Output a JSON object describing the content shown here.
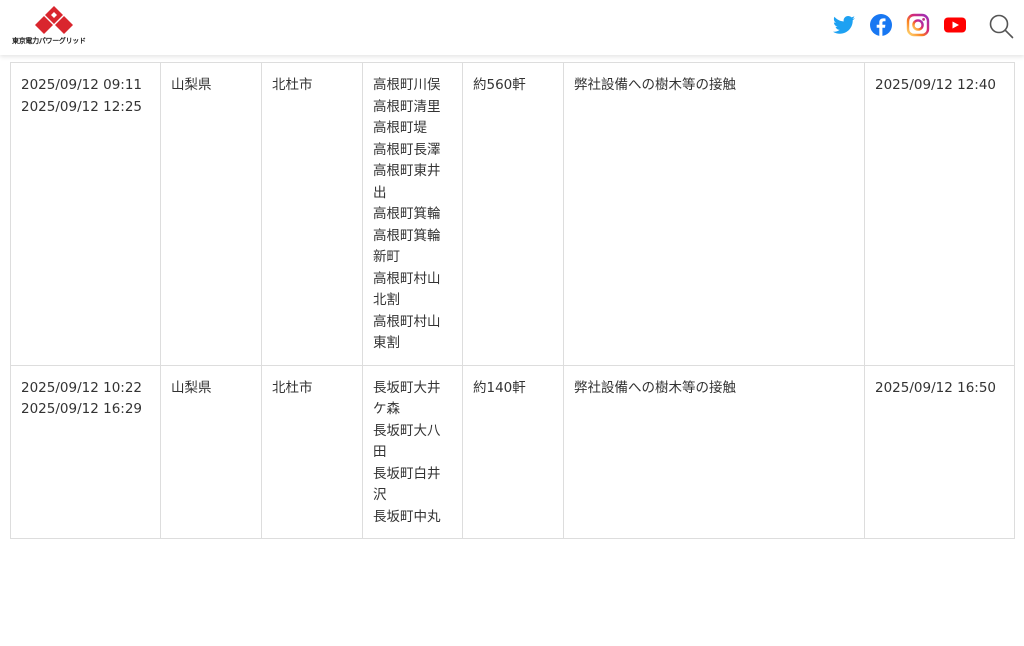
{
  "header": {
    "logo_text": "東京電力パワーグリッド",
    "brand_color": "#d9262e",
    "social": [
      {
        "name": "twitter",
        "icon": "twitter-icon",
        "color": "#1da1f2"
      },
      {
        "name": "facebook",
        "icon": "facebook-icon",
        "color": "#1877f2"
      },
      {
        "name": "instagram",
        "icon": "instagram-icon",
        "color": "#e1306c"
      },
      {
        "name": "youtube",
        "icon": "youtube-icon",
        "color": "#ff0000"
      }
    ],
    "search_icon": "search-icon"
  },
  "outages": [
    {
      "occurred": "2025/09/12 09:11",
      "restored": "2025/09/12 12:25",
      "prefecture": "山梨県",
      "city": "北杜市",
      "areas": [
        "高根町川俣",
        "高根町清里",
        "高根町堤",
        "高根町長澤",
        "高根町東井出",
        "高根町箕輪",
        "高根町箕輪新町",
        "高根町村山北割",
        "高根町村山東割"
      ],
      "households": "約560軒",
      "cause": "弊社設備への樹木等の接触",
      "updated": "2025/09/12 12:40"
    },
    {
      "occurred": "2025/09/12 10:22",
      "restored": "2025/09/12 16:29",
      "prefecture": "山梨県",
      "city": "北杜市",
      "areas": [
        "長坂町大井ケ森",
        "長坂町大八田",
        "長坂町白井沢",
        "長坂町中丸"
      ],
      "households": "約140軒",
      "cause": "弊社設備への樹木等の接触",
      "updated": "2025/09/12 16:50"
    }
  ]
}
